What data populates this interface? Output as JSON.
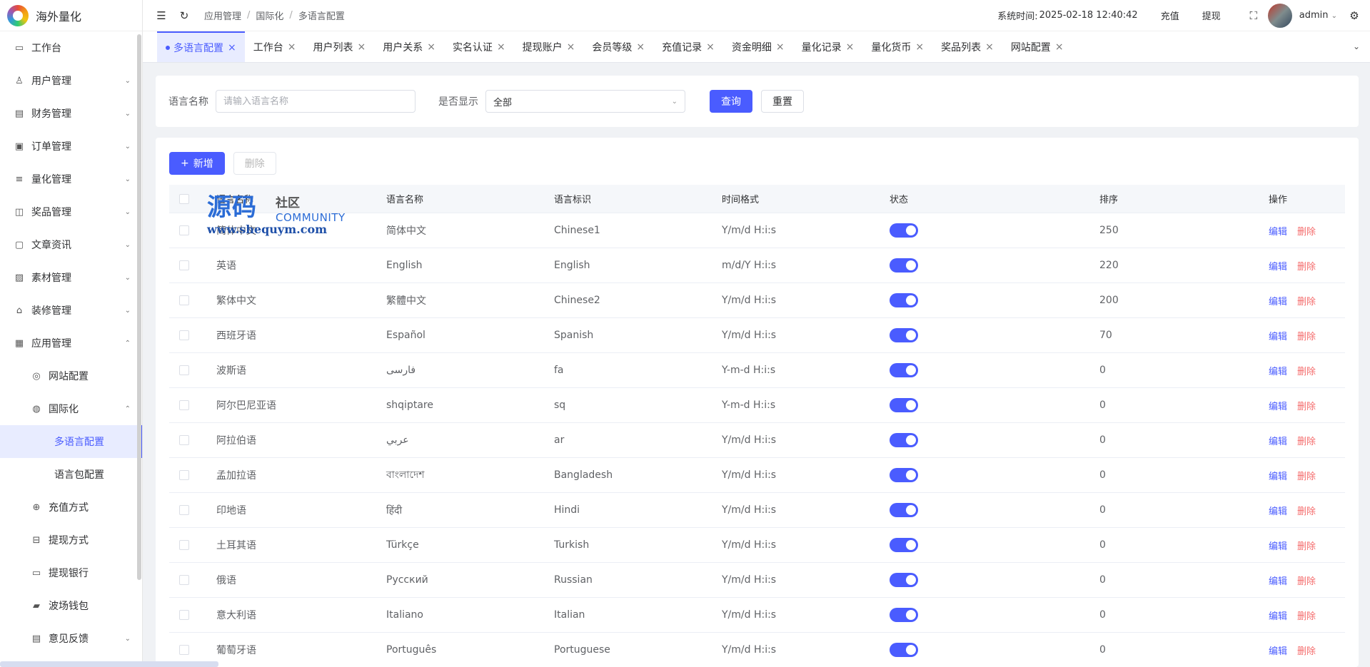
{
  "app": {
    "title": "海外量化"
  },
  "sidebar": {
    "items": [
      {
        "label": "工作台",
        "icon": "monitor-icon",
        "chev": ""
      },
      {
        "label": "用户管理",
        "icon": "user-icon",
        "chev": "⌄"
      },
      {
        "label": "财务管理",
        "icon": "chart-icon",
        "chev": "⌄"
      },
      {
        "label": "订单管理",
        "icon": "order-icon",
        "chev": "⌄"
      },
      {
        "label": "量化管理",
        "icon": "quant-icon",
        "chev": "⌄"
      },
      {
        "label": "奖品管理",
        "icon": "bag-icon",
        "chev": "⌄"
      },
      {
        "label": "文章资讯",
        "icon": "article-icon",
        "chev": "⌄"
      },
      {
        "label": "素材管理",
        "icon": "image-icon",
        "chev": "⌄"
      },
      {
        "label": "装修管理",
        "icon": "decor-icon",
        "chev": "⌄"
      },
      {
        "label": "应用管理",
        "icon": "app-icon",
        "chev": "⌃"
      }
    ],
    "sub_items": [
      {
        "label": "网站配置",
        "icon": "globe-icon",
        "chev": ""
      },
      {
        "label": "国际化",
        "icon": "i18n-icon",
        "chev": "⌃"
      }
    ],
    "sub2_items": [
      {
        "label": "多语言配置"
      },
      {
        "label": "语言包配置"
      }
    ],
    "sub_items_after": [
      {
        "label": "充值方式",
        "icon": "recharge-icon",
        "chev": ""
      },
      {
        "label": "提现方式",
        "icon": "withdraw-icon",
        "chev": ""
      },
      {
        "label": "提现银行",
        "icon": "bank-icon",
        "chev": ""
      },
      {
        "label": "波场钱包",
        "icon": "wallet-icon",
        "chev": ""
      },
      {
        "label": "意见反馈",
        "icon": "feedback-icon",
        "chev": "⌄"
      }
    ]
  },
  "header": {
    "breadcrumb": [
      "应用管理",
      "国际化",
      "多语言配置"
    ],
    "time_label": "系统时间:",
    "time_value": "2025-02-18 12:40:42",
    "recharge": "充值",
    "withdraw": "提现",
    "user": "admin"
  },
  "tabs": [
    "工作台",
    "用户列表",
    "用户关系",
    "实名认证",
    "提现账户",
    "会员等级",
    "充值记录",
    "资金明细",
    "量化记录",
    "量化货币",
    "奖品列表",
    "网站配置"
  ],
  "active_tab": "多语言配置",
  "search": {
    "name_label": "语言名称",
    "name_placeholder": "请输入语言名称",
    "show_label": "是否显示",
    "show_value": "全部",
    "query": "查询",
    "reset": "重置"
  },
  "toolbar": {
    "add": "新增",
    "delete": "删除"
  },
  "table": {
    "headers": [
      "语言名称",
      "语言名称",
      "语言标识",
      "时间格式",
      "状态",
      "排序",
      "操作"
    ],
    "edit": "编辑",
    "del": "删除",
    "rows": [
      [
        "简体中文",
        "简体中文",
        "Chinese1",
        "Y/m/d H:i:s",
        "250"
      ],
      [
        "英语",
        "English",
        "English",
        "m/d/Y H:i:s",
        "220"
      ],
      [
        "繁体中文",
        "繁體中文",
        "Chinese2",
        "Y/m/d H:i:s",
        "200"
      ],
      [
        "西班牙语",
        "Español",
        "Spanish",
        "Y/m/d H:i:s",
        "70"
      ],
      [
        "波斯语",
        "فارسی",
        "fa",
        "Y-m-d H:i:s",
        "0"
      ],
      [
        "阿尔巴尼亚语",
        "shqiptare",
        "sq",
        "Y-m-d H:i:s",
        "0"
      ],
      [
        "阿拉伯语",
        "عربي",
        "ar",
        "Y/m/d H:i:s",
        "0"
      ],
      [
        "孟加拉语",
        "বাংলাদেশ",
        "Bangladesh",
        "Y/m/d H:i:s",
        "0"
      ],
      [
        "印地语",
        "हिंदी",
        "Hindi",
        "Y/m/d H:i:s",
        "0"
      ],
      [
        "土耳其语",
        "Türkçe",
        "Turkish",
        "Y/m/d H:i:s",
        "0"
      ],
      [
        "俄语",
        "Русский",
        "Russian",
        "Y/m/d H:i:s",
        "0"
      ],
      [
        "意大利语",
        "Italiano",
        "Italian",
        "Y/m/d H:i:s",
        "0"
      ],
      [
        "葡萄牙语",
        "Português",
        "Portuguese",
        "Y/m/d H:i:s",
        "0"
      ]
    ]
  },
  "watermark": {
    "big": "源码",
    "small": "社区",
    "community": "COMMUNITY",
    "url": "www.shequym.com"
  },
  "colors": {
    "accent": "#4a5cff",
    "danger": "#f56c6c"
  }
}
